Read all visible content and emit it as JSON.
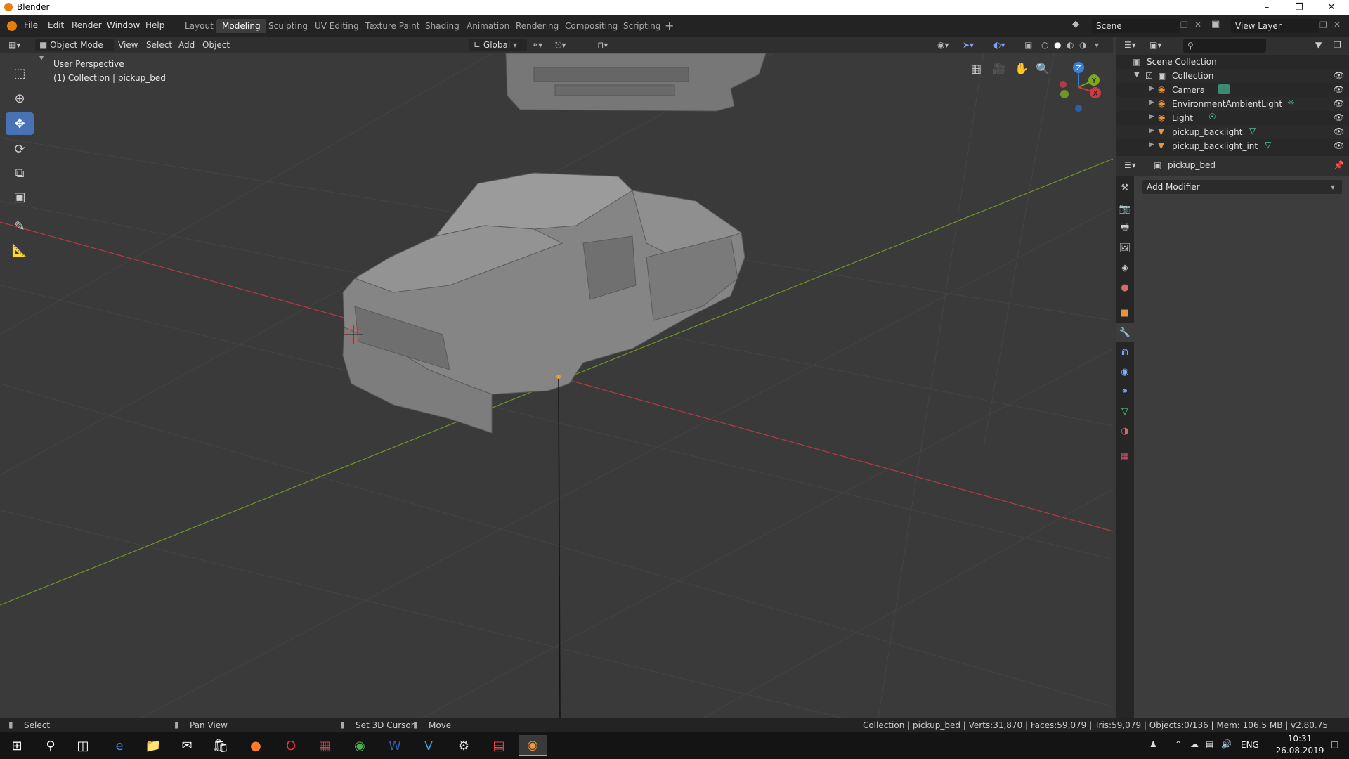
{
  "window": {
    "title": "Blender"
  },
  "menu": [
    "File",
    "Edit",
    "Render",
    "Window",
    "Help"
  ],
  "workspaces": [
    "Layout",
    "Modeling",
    "Sculpting",
    "UV Editing",
    "Texture Paint",
    "Shading",
    "Animation",
    "Rendering",
    "Compositing",
    "Scripting"
  ],
  "active_workspace": "Modeling",
  "scene": {
    "name": "Scene",
    "view_layer": "View Layer"
  },
  "viewport_header": {
    "mode": "Object Mode",
    "menus": [
      "View",
      "Select",
      "Add",
      "Object"
    ],
    "orientation": "Global"
  },
  "viewport": {
    "perspective_label": "User Perspective",
    "collection_label": "(1) Collection | pickup_bed",
    "gizmo": {
      "z": "Z",
      "y": "Y",
      "x": "X"
    }
  },
  "outliner": {
    "root": "Scene Collection",
    "collection": "Collection",
    "items": [
      {
        "name": "Camera",
        "icon": "camera-icon"
      },
      {
        "name": "EnvironmentAmbientLight",
        "icon": "light-icon"
      },
      {
        "name": "Light",
        "icon": "light-icon"
      },
      {
        "name": "pickup_backlight",
        "icon": "mesh-icon"
      },
      {
        "name": "pickup_backlight_int",
        "icon": "mesh-icon"
      }
    ]
  },
  "properties": {
    "object_name": "pickup_bed",
    "add_modifier": "Add Modifier"
  },
  "statusbar": {
    "select": "Select",
    "pan_view": "Pan View",
    "set_cursor": "Set 3D Cursor",
    "move": "Move",
    "stats": "Collection | pickup_bed | Verts:31,870 | Faces:59,079 | Tris:59,079 | Objects:0/136 | Mem: 106.5 MB | v2.80.75"
  },
  "taskbar": {
    "lang": "ENG",
    "time": "10:31",
    "date": "26.08.2019"
  },
  "colors": {
    "accent": "#4772b3",
    "x_axis": "#c83c46",
    "y_axis": "#7ea81e",
    "z_axis": "#3d7fd6"
  }
}
